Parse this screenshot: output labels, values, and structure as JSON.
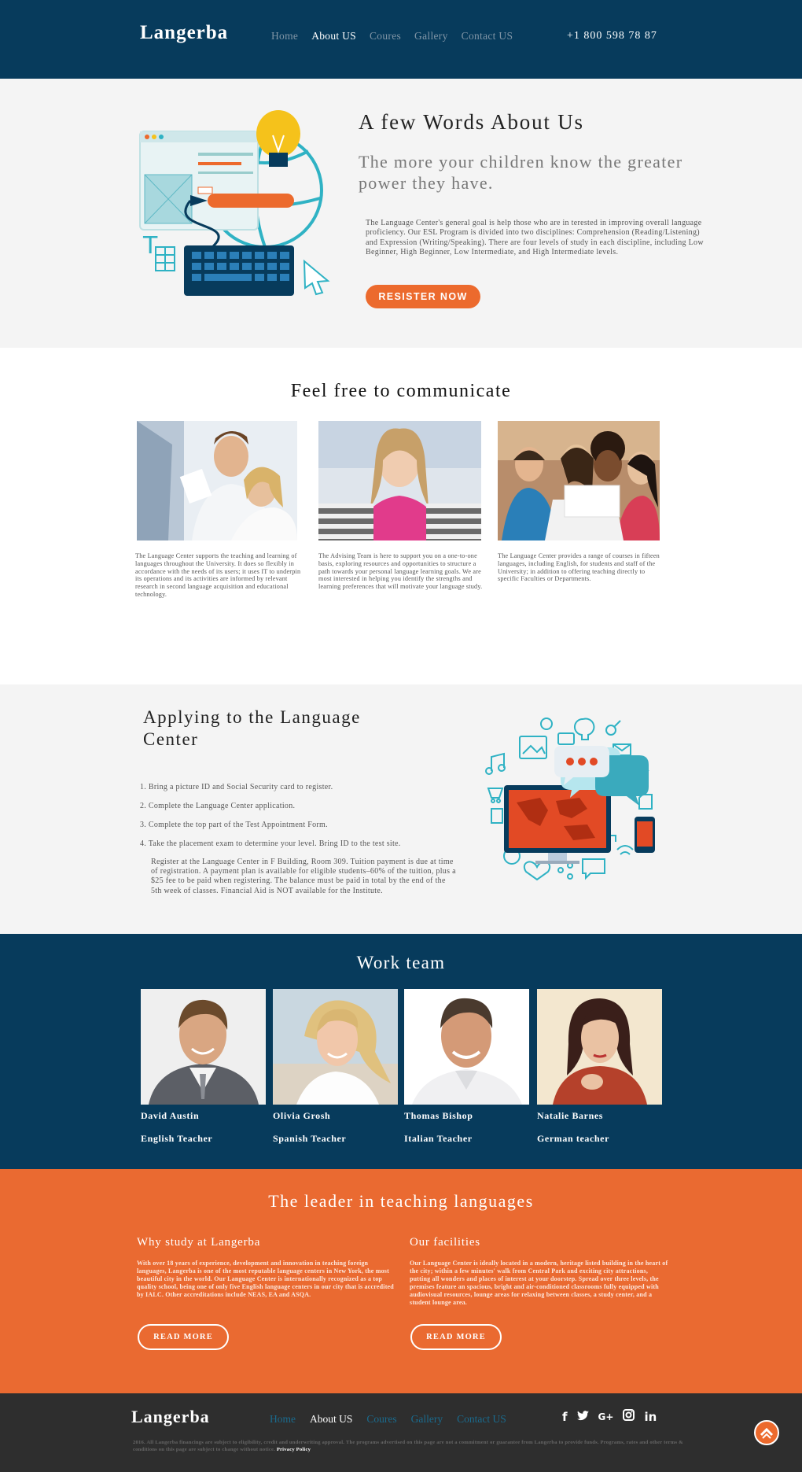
{
  "header": {
    "logo": "Langerba",
    "nav": [
      "Home",
      "About US",
      "Coures",
      "Gallery",
      "Contact US"
    ],
    "active_nav": "About US",
    "phone": "+1 800 598 78 87"
  },
  "about": {
    "title": "A few Words About Us",
    "tagline": "The more your children know the greater power they have.",
    "description": "The Language Center's general goal is help those who are in terested in improving overall language proficiency. Our ESL Program is divided into two disciplines: Comprehension (Reading/Listening) and Expression (Writing/Speaking). There are four levels of study in each discipline, including Low Beginner, High Beginner, Low Intermediate, and High Intermediate levels.",
    "cta": "RESISTER NOW"
  },
  "communicate": {
    "title": "Feel free to communicate",
    "cards": [
      {
        "text": "The Language Center supports the teaching and learning of languages throughout the University. It does so flexibly in accordance with the needs of its users; it uses IT to underpin its operations and its activities are informed by relevant research in second language acquisition and educational technology."
      },
      {
        "text": "The Advising Team is here to support you on a one-to-one basis, exploring resources and opportunities to structure a path towards your personal language learning goals. We are most interested in helping you identify the strengths and learning preferences that will motivate your language study."
      },
      {
        "text": "The Language Center provides a range of courses in fifteen languages, including English, for students and staff of the University; in addition to offering teaching directly to specific Faculties or Departments."
      }
    ]
  },
  "applying": {
    "title": "Applying to the Language Center",
    "steps": [
      "1. Bring a picture ID and Social Security card to register.",
      "2. Complete the Language Center application.",
      "3. Complete the top part of the Test Appointment Form.",
      "4. Take the placement exam to determine your level. Bring ID to the test site."
    ],
    "note": "Register at the Language Center in F Building, Room 309. Tuition payment is due at time of registration. A payment plan is available for eligible students–60% of the tuition, plus a $25 fee to be paid when registering. The balance must be paid in total by the end of the 5th week of classes. Financial Aid is NOT available for the Institute."
  },
  "team": {
    "title": "Work team",
    "members": [
      {
        "name": "David Austin",
        "role": "English Teacher"
      },
      {
        "name": "Olivia Grosh",
        "role": "Spanish Teacher"
      },
      {
        "name": "Thomas Bishop",
        "role": "Italian Teacher"
      },
      {
        "name": "Natalie Barnes",
        "role": "German teacher"
      }
    ]
  },
  "leader": {
    "title": "The leader in teaching languages",
    "why_title": "Why study at Langerba",
    "why_text": "With over 18 years of experience, development and innovation in teaching foreign languages, Langerba is one of the most reputable language centers in New York, the most beautiful city in the world. Our Language Center is internationally recognized as a top quality school, being one of only five English language centers in our city that is accredited by IALC. Other accreditations include NEAS, EA and ASQA.",
    "facilities_title": "Our facilities",
    "facilities_text": "Our Language Center is ideally located in a modern, heritage listed building in the heart of the city; within a few minutes' walk from Central Park and exciting city attractions, putting all wonders and places of interest at your doorstep. Spread over three levels, the premises feature an spacious, bright and air-conditioned classrooms fully equipped with audiovisual resources, lounge areas for relaxing between classes, a study center, and a student lounge area.",
    "read_more": "READ MORE"
  },
  "footer": {
    "logo": "Langerba",
    "nav": [
      "Home",
      "About US",
      "Coures",
      "Gallery",
      "Contact US"
    ],
    "active_nav": "About US",
    "legal": "2016. All Langerba financings are subject to eligibility, credit and underwriting approval. The programs advertised on this page are not a commitment or guarantee from Langerba to provide funds. Programs, rates and other terms & conditions on this page are subject to change without notice.",
    "privacy": "Privacy Policy",
    "social": [
      "facebook-icon",
      "twitter-icon",
      "google-plus-icon",
      "instagram-icon",
      "linkedin-icon"
    ]
  },
  "colors": {
    "navy": "#073b5c",
    "orange": "#ea6a31",
    "light_bg": "#f4f4f4",
    "footer_bg": "#2e2e2e"
  }
}
